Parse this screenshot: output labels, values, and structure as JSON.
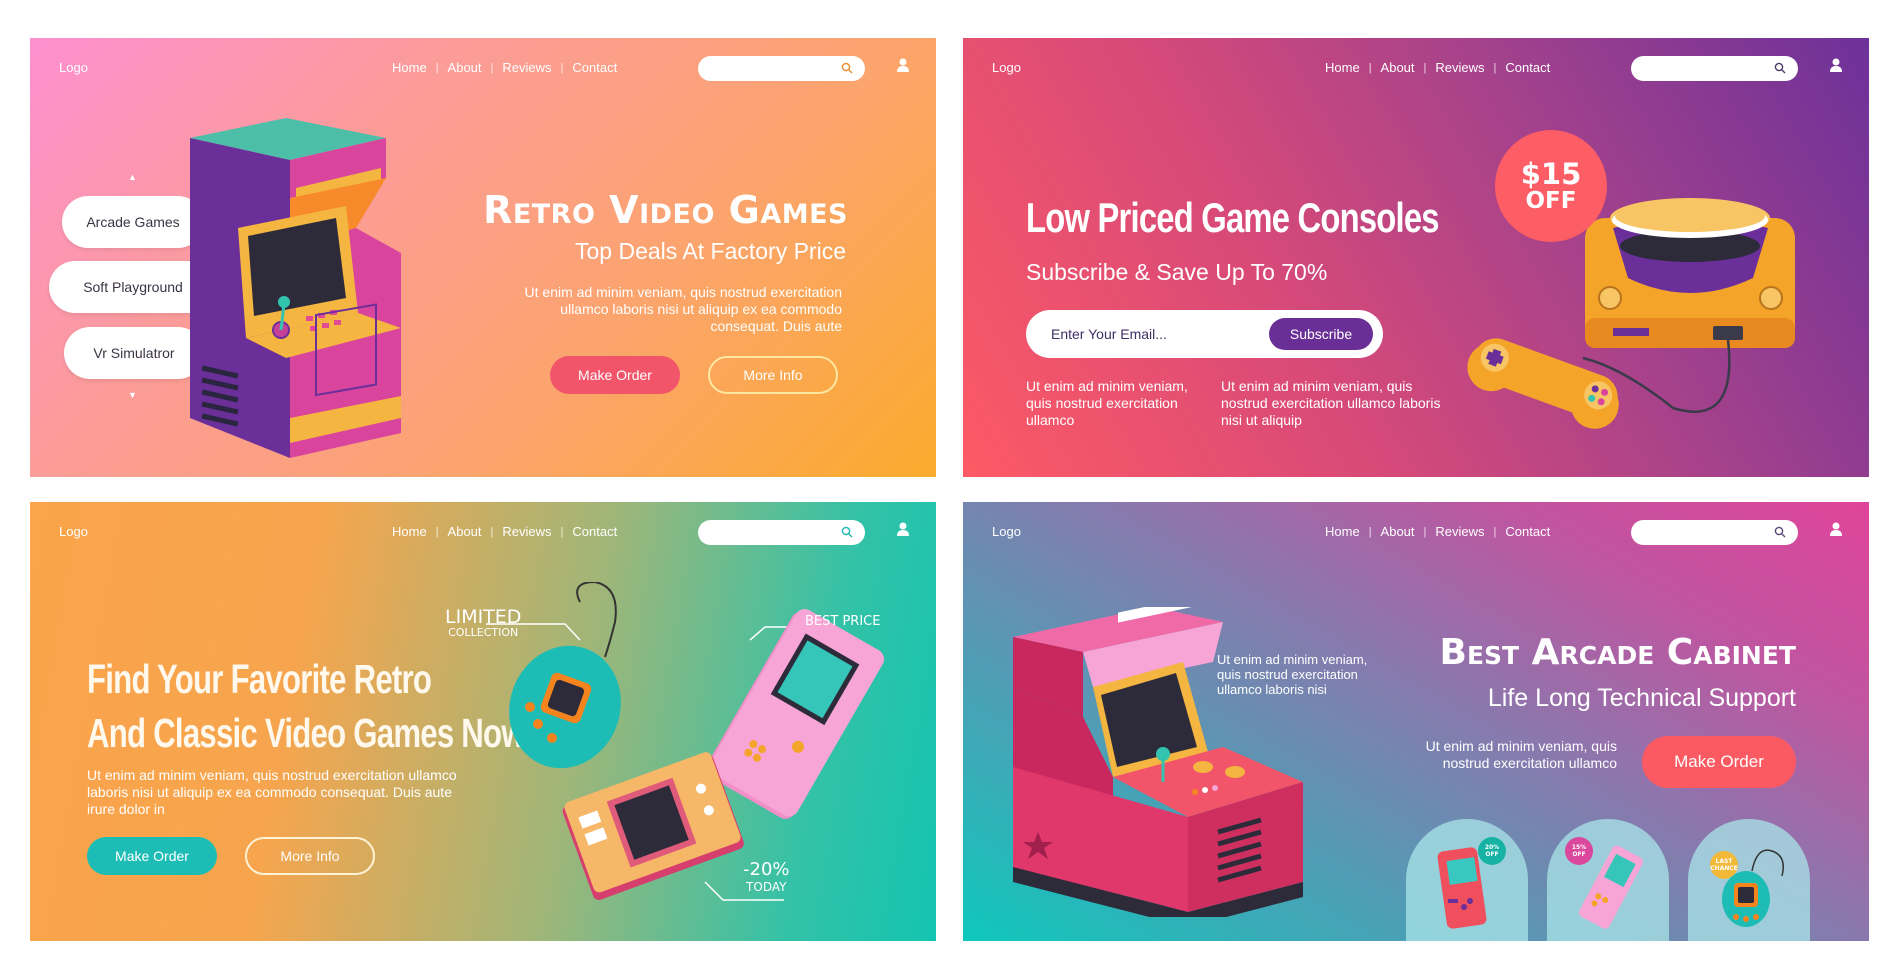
{
  "shared_nav": {
    "logo": "Logo",
    "links": [
      "Home",
      "About",
      "Reviews",
      "Contact"
    ],
    "search_placeholder": "",
    "icons": {
      "search": "search-icon",
      "user": "user-icon"
    }
  },
  "panels": [
    {
      "id": "retro-video-games",
      "colors": {
        "gradient_start": "#fd8fd0",
        "gradient_end": "#fbab2d",
        "search_icon": "#e98a2a"
      },
      "sidebar": {
        "up_arrow": "▲",
        "items": [
          "Arcade Games",
          "Soft Playground",
          "Vr Simulatror"
        ],
        "down_arrow": "▼"
      },
      "title": "Retro Video Games",
      "subtitle": "Top Deals At Factory Price",
      "body": "Ut enim ad minim veniam, quis nostrud exercitation ullamco laboris nisi ut aliquip ex ea commodo consequat. Duis aute",
      "buttons": {
        "primary": "Make Order",
        "secondary": "More Info"
      },
      "button_colors": {
        "primary": "#f2546a",
        "secondary_border": "#ffe7a0"
      },
      "illustration": "arcade-cabinet"
    },
    {
      "id": "low-priced-consoles",
      "colors": {
        "gradient_start": "#fd5a64",
        "gradient_end": "#6d3199",
        "search_icon": "#4a3a6a"
      },
      "title": "Low Priced Game Consoles",
      "subtitle": "Subscribe & Save Up To 70%",
      "email_placeholder": "Enter Your Email...",
      "subscribe_label": "Subscribe",
      "subscribe_color": "#6a2f96",
      "body_left": "Ut enim ad minim veniam, quis nostrud exercitation ullamco",
      "body_right": "Ut enim ad minim veniam, quis nostrud exercitation ullamco laboris nisi ut aliquip",
      "discount_badge": {
        "amount": "$15",
        "label": "OFF",
        "color": "#fd5d64"
      },
      "illustration": "game-console-with-controller"
    },
    {
      "id": "favorite-retro",
      "colors": {
        "gradient_start": "#fba44a",
        "gradient_end": "#14c4b0",
        "search_icon": "#1fb6b0"
      },
      "title_line1": "Find Your Favorite Retro",
      "title_line2": "And Classic Video Games Now",
      "body": "Ut enim ad minim veniam, quis nostrud exercitation ullamco laboris nisi ut aliquip ex ea commodo consequat. Duis aute irure dolor in",
      "buttons": {
        "primary": "Make Order",
        "secondary": "More Info"
      },
      "button_colors": {
        "primary": "#1dbdb5",
        "secondary_border": "#fff3d6"
      },
      "tags": {
        "limited_big": "LIMITED",
        "limited_small": "COLLECTION",
        "best_price": "BEST PRICE",
        "discount_big": "-20%",
        "discount_small": "TODAY"
      },
      "illustration": "handheld-games"
    },
    {
      "id": "best-arcade-cabinet",
      "colors": {
        "gradient_start": "#0ec8bc",
        "gradient_end": "#e0449a",
        "search_icon": "#5a4a7a"
      },
      "title": "Best Arcade Cabinet",
      "subtitle": "Life Long Technical Support",
      "body_right": "Ut enim ad minim veniam, quis nostrud exercitation ullamco",
      "body_left": "Ut enim ad minim veniam, quis nostrud exercitation ullamco laboris nisi",
      "buttons": {
        "primary": "Make Order"
      },
      "button_colors": {
        "primary": "#fb5a62"
      },
      "products": [
        {
          "badge": "20% OFF",
          "badge_line1": "20%",
          "badge_line2": "OFF",
          "badge_color": "#16b3a4",
          "item": "red-handheld"
        },
        {
          "badge": "15% OFF",
          "badge_line1": "15%",
          "badge_line2": "OFF",
          "badge_color": "#d9489c",
          "item": "pink-handheld"
        },
        {
          "badge": "LAST CHANCE",
          "badge_line1": "LAST",
          "badge_line2": "CHANCE",
          "badge_color": "#f2b838",
          "item": "teal-tamagotchi"
        }
      ],
      "illustration": "sit-down-arcade-cabinet"
    }
  ]
}
